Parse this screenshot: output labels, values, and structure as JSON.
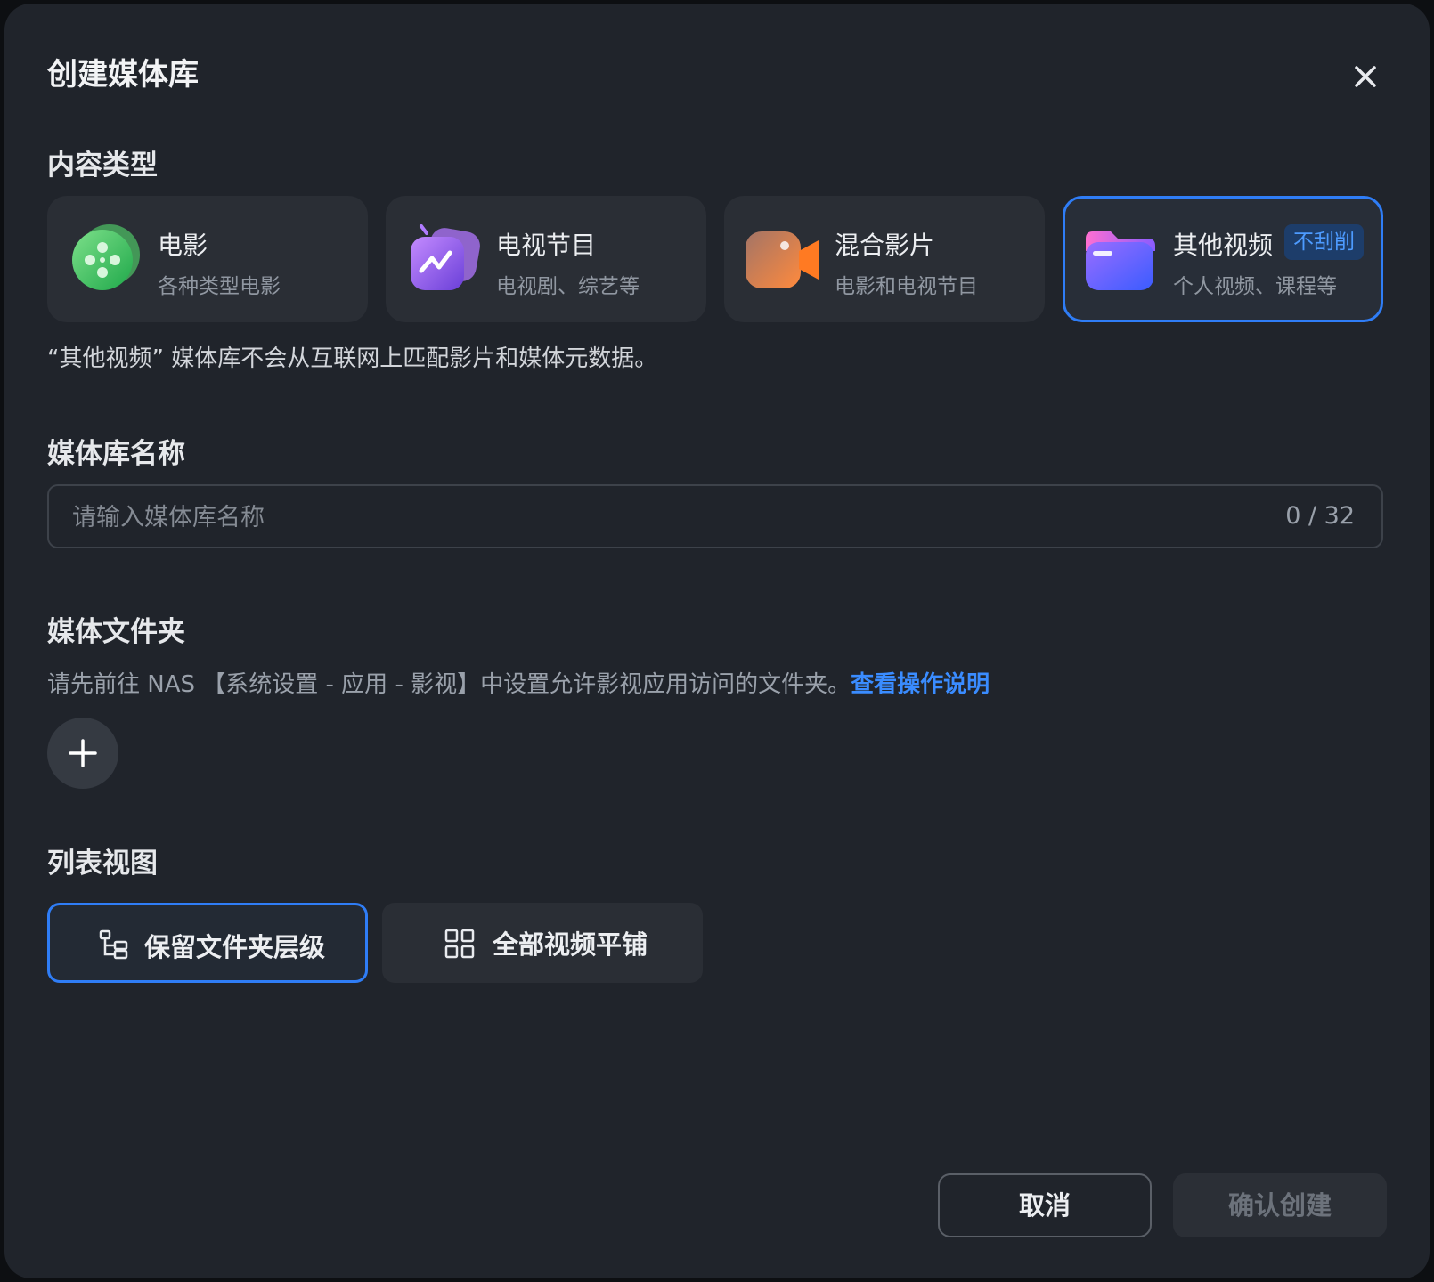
{
  "dialog": {
    "title": "创建媒体库"
  },
  "content_type": {
    "label": "内容类型",
    "options": [
      {
        "name": "电影",
        "desc": "各种类型电影",
        "icon": "film-reel-icon"
      },
      {
        "name": "电视节目",
        "desc": "电视剧、综艺等",
        "icon": "tv-icon"
      },
      {
        "name": "混合影片",
        "desc": "电影和电视节目",
        "icon": "video-camera-icon"
      },
      {
        "name": "其他视频",
        "desc": "个人视频、课程等",
        "icon": "folder-icon",
        "badge": "不刮削",
        "selected": true
      }
    ],
    "hint": "“其他视频” 媒体库不会从互联网上匹配影片和媒体元数据。"
  },
  "library_name": {
    "label": "媒体库名称",
    "placeholder": "请输入媒体库名称",
    "value": "",
    "counter": "0 / 32"
  },
  "media_folder": {
    "label": "媒体文件夹",
    "hint": "请先前往 NAS 【系统设置 - 应用 - 影视】中设置允许影视应用访问的文件夹。",
    "link": "查看操作说明"
  },
  "list_view": {
    "label": "列表视图",
    "options": [
      {
        "label": "保留文件夹层级",
        "icon": "folder-tree-icon",
        "selected": true
      },
      {
        "label": "全部视频平铺",
        "icon": "grid-icon",
        "selected": false
      }
    ]
  },
  "footer": {
    "cancel": "取消",
    "confirm": "确认创建"
  },
  "colors": {
    "accent": "#2f7df6",
    "link": "#3a8cff",
    "background": "#20242b"
  }
}
